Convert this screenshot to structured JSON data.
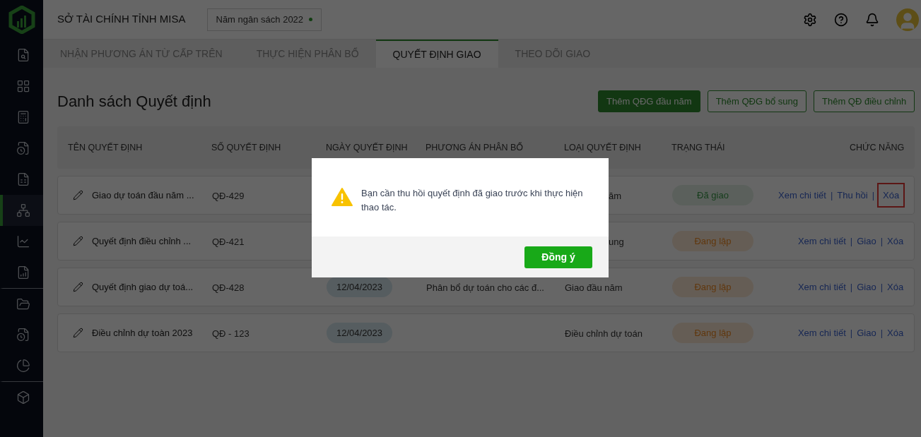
{
  "header": {
    "org": "SỞ TÀI CHÍNH TỈNH MISA",
    "year": "Năm ngân sách 2022"
  },
  "sidebar": {
    "items": [
      {
        "kind": "search",
        "selected": false,
        "divider": false
      },
      {
        "kind": "grid",
        "selected": false,
        "divider": false
      },
      {
        "kind": "calc",
        "selected": false,
        "divider": false
      },
      {
        "kind": "clock",
        "selected": false,
        "divider": false
      },
      {
        "kind": "sheet",
        "selected": false,
        "divider": false
      },
      {
        "kind": "tree",
        "selected": true,
        "divider": false
      },
      {
        "kind": "chart",
        "selected": false,
        "divider": false
      },
      {
        "kind": "report",
        "selected": false,
        "divider": false
      },
      {
        "kind": "folder",
        "divider": true,
        "selected": false
      },
      {
        "kind": "file",
        "selected": false,
        "divider": false
      },
      {
        "kind": "pie",
        "selected": false,
        "divider": false
      },
      {
        "kind": "cube",
        "divider": true,
        "selected": false
      }
    ]
  },
  "tabs": [
    {
      "label": "NHẬN PHƯƠNG ÁN TỪ CẤP TRÊN",
      "selected": false
    },
    {
      "label": "THỰC HIỆN PHÂN BỔ",
      "selected": false
    },
    {
      "label": "QUYẾT ĐỊNH GIAO",
      "selected": true
    },
    {
      "label": "THEO DÕI GIAO",
      "selected": false
    }
  ],
  "page_title": "Danh sách Quyết định",
  "buttons": [
    {
      "label": "Thêm QĐG đầu năm",
      "kind": "primary"
    },
    {
      "label": "Thêm QĐG bổ sung",
      "kind": "outline"
    },
    {
      "label": "Thêm QĐ điều chỉnh",
      "kind": "outline"
    }
  ],
  "table": {
    "action_separator": "|",
    "columns": [
      "TÊN QUYẾT ĐỊNH",
      "SỐ QUYẾT ĐỊNH",
      "NGÀY QUYẾT ĐỊNH",
      "PHƯƠNG ÁN PHÂN BỔ",
      "LOẠI QUYẾT ĐỊNH",
      "TRẠNG THÁI",
      "CHỨC NĂNG"
    ],
    "rows": [
      {
        "name": "Giao dự toán đầu năm ...",
        "number": "QĐ-429",
        "type": "ăm",
        "type_cut": true,
        "status": {
          "label": "Đã giao",
          "kind": "done"
        },
        "actions": [
          {
            "label": "Xem chi tiết",
            "highlighted": false
          },
          {
            "label": "Thu hồi",
            "highlighted": false
          },
          {
            "label": "Xóa",
            "highlighted": true
          }
        ]
      },
      {
        "name": "Quyết định điều chỉnh ...",
        "number": "QĐ-421",
        "type": "ung",
        "type_cut": true,
        "status": {
          "label": "Đang lập",
          "kind": "draft"
        },
        "actions": [
          {
            "label": "Xem chi tiết",
            "highlighted": false
          },
          {
            "label": "Giao",
            "highlighted": false
          },
          {
            "label": "Xóa",
            "highlighted": false
          }
        ]
      },
      {
        "name": "Quyết định giao dự toá...",
        "number": "QĐ-428",
        "date": "12/04/2023",
        "plan": "Phân bổ dự toán cho các đ...",
        "type": "Giao đầu năm",
        "type_cut": false,
        "status": {
          "label": "Đang lập",
          "kind": "draft"
        },
        "actions": [
          {
            "label": "Xem chi tiết",
            "highlighted": false
          },
          {
            "label": "Giao",
            "highlighted": false
          },
          {
            "label": "Xóa",
            "highlighted": false
          }
        ]
      },
      {
        "name": "Điều chỉnh dự toàn 2023",
        "number": "QĐ - 123",
        "date": "12/04/2023",
        "type": "Điều chỉnh dự toán",
        "type_cut": false,
        "status": {
          "label": "Đang lập",
          "kind": "draft"
        },
        "actions": [
          {
            "label": "Xem chi tiết",
            "highlighted": false
          },
          {
            "label": "Giao",
            "highlighted": false
          },
          {
            "label": "Xóa",
            "highlighted": false
          }
        ]
      }
    ]
  },
  "dialog": {
    "message": "Bạn cần thu hồi quyết định đã giao trước khi thực hiện thao tác.",
    "button": "Đồng ý"
  }
}
